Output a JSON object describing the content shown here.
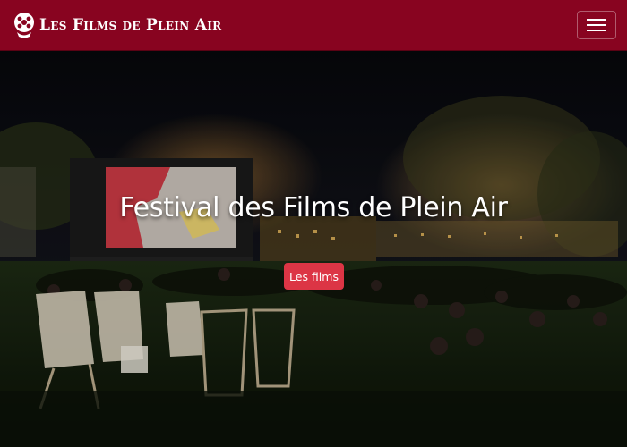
{
  "navbar": {
    "brand_text": "Les Films de Plein Air",
    "logo_icon": "reel-icon",
    "menu_icon": "hamburger-icon",
    "background_color": "#880420"
  },
  "hero": {
    "title": "Festival des Films de Plein Air",
    "button_label": "Les films",
    "button_color": "#dc3545"
  }
}
